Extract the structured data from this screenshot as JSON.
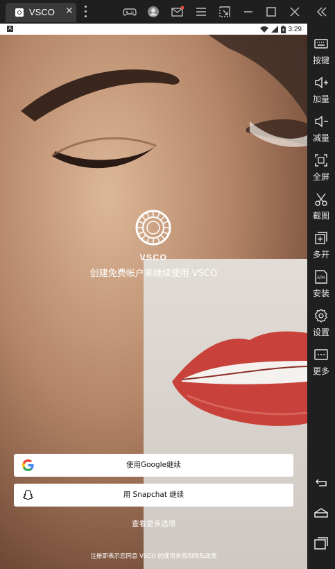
{
  "window": {
    "tab_title": "VSCO",
    "tab_close": "✕"
  },
  "statusbar": {
    "notif_icon": "A",
    "time": "3:29"
  },
  "app": {
    "brand": "VSCO",
    "headline": "创建免费帐户来继续使用 VSCO",
    "google_button": "使用Google继续",
    "snapchat_button": "用 Snapchat 继续",
    "more_options": "查看更多选项",
    "terms": "注册即表示您同意 VSCO 的使用条款和隐私政策"
  },
  "sidebar": {
    "items": [
      {
        "label": "按键",
        "icon": "keyboard-icon"
      },
      {
        "label": "加量",
        "icon": "volume-up-icon"
      },
      {
        "label": "减量",
        "icon": "volume-down-icon"
      },
      {
        "label": "全屏",
        "icon": "fullscreen-icon"
      },
      {
        "label": "截图",
        "icon": "scissors-icon"
      },
      {
        "label": "多开",
        "icon": "multi-instance-icon"
      },
      {
        "label": "安装",
        "icon": "apk-icon"
      },
      {
        "label": "设置",
        "icon": "gear-icon"
      },
      {
        "label": "更多",
        "icon": "more-icon"
      }
    ],
    "nav": [
      "back-icon",
      "home-icon",
      "recents-icon"
    ]
  },
  "colors": {
    "emulator_bg": "#1f1f1f",
    "button_bg": "#ffffff",
    "lip_red": "#c8413a"
  }
}
